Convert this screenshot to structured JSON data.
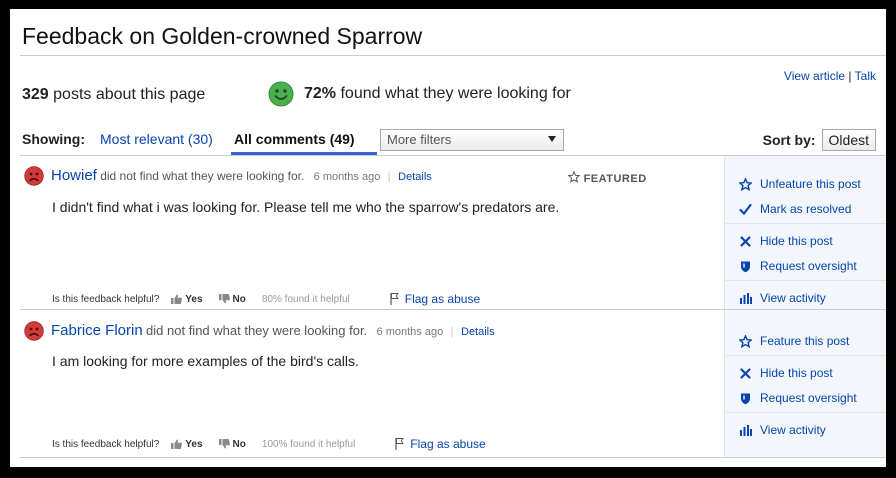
{
  "page": {
    "title": "Feedback on Golden-crowned Sparrow",
    "view_article": "View article",
    "talk": "Talk",
    "links_sep": "|"
  },
  "summary": {
    "post_count": "329",
    "post_label": "posts about this page",
    "found_pct": "72%",
    "found_label": "found what they were looking for"
  },
  "filters": {
    "showing_label": "Showing:",
    "most_relevant": "Most relevant (30)",
    "all_comments": "All comments (49)",
    "more_filters": "More filters",
    "sort_label": "Sort by:",
    "sort_value": "Oldest"
  },
  "posts": [
    {
      "author": "Howief",
      "status": "did not find what they were looking for.",
      "time": "6 months ago",
      "sep": "|",
      "details": "Details",
      "featured": "FEATURED",
      "text": "I didn't find what i was looking for. Please tell me who the sparrow's predators are.",
      "helpful_q": "Is this feedback helpful?",
      "yes": "Yes",
      "no": "No",
      "helpful_pct": "80% found it helpful",
      "flag": "Flag as abuse",
      "actions": [
        "Unfeature this post",
        "Mark as resolved",
        "Hide this post",
        "Request oversight",
        "View activity"
      ]
    },
    {
      "author": "Fabrice Florin",
      "status": "did not find what they were looking for.",
      "time": "6 months ago",
      "sep": "|",
      "details": "Details",
      "text": "I am looking for more examples of the bird's calls.",
      "helpful_q": "Is this feedback helpful?",
      "yes": "Yes",
      "no": "No",
      "helpful_pct": "100% found it helpful",
      "flag": "Flag as abuse",
      "actions": [
        "Feature this post",
        "Hide this post",
        "Request oversight",
        "View activity"
      ]
    }
  ],
  "colors": {
    "link": "#0645ad",
    "accent": "#3366cc",
    "smiley_green": "#4caf50",
    "frown_red": "#d33b3b"
  },
  "icons": [
    "smiley-icon",
    "frown-icon",
    "thumbs-up-icon",
    "thumbs-down-icon",
    "flag-icon",
    "star-icon",
    "check-icon",
    "x-icon",
    "shield-icon",
    "bar-chart-icon",
    "dropdown-arrow-icon"
  ]
}
